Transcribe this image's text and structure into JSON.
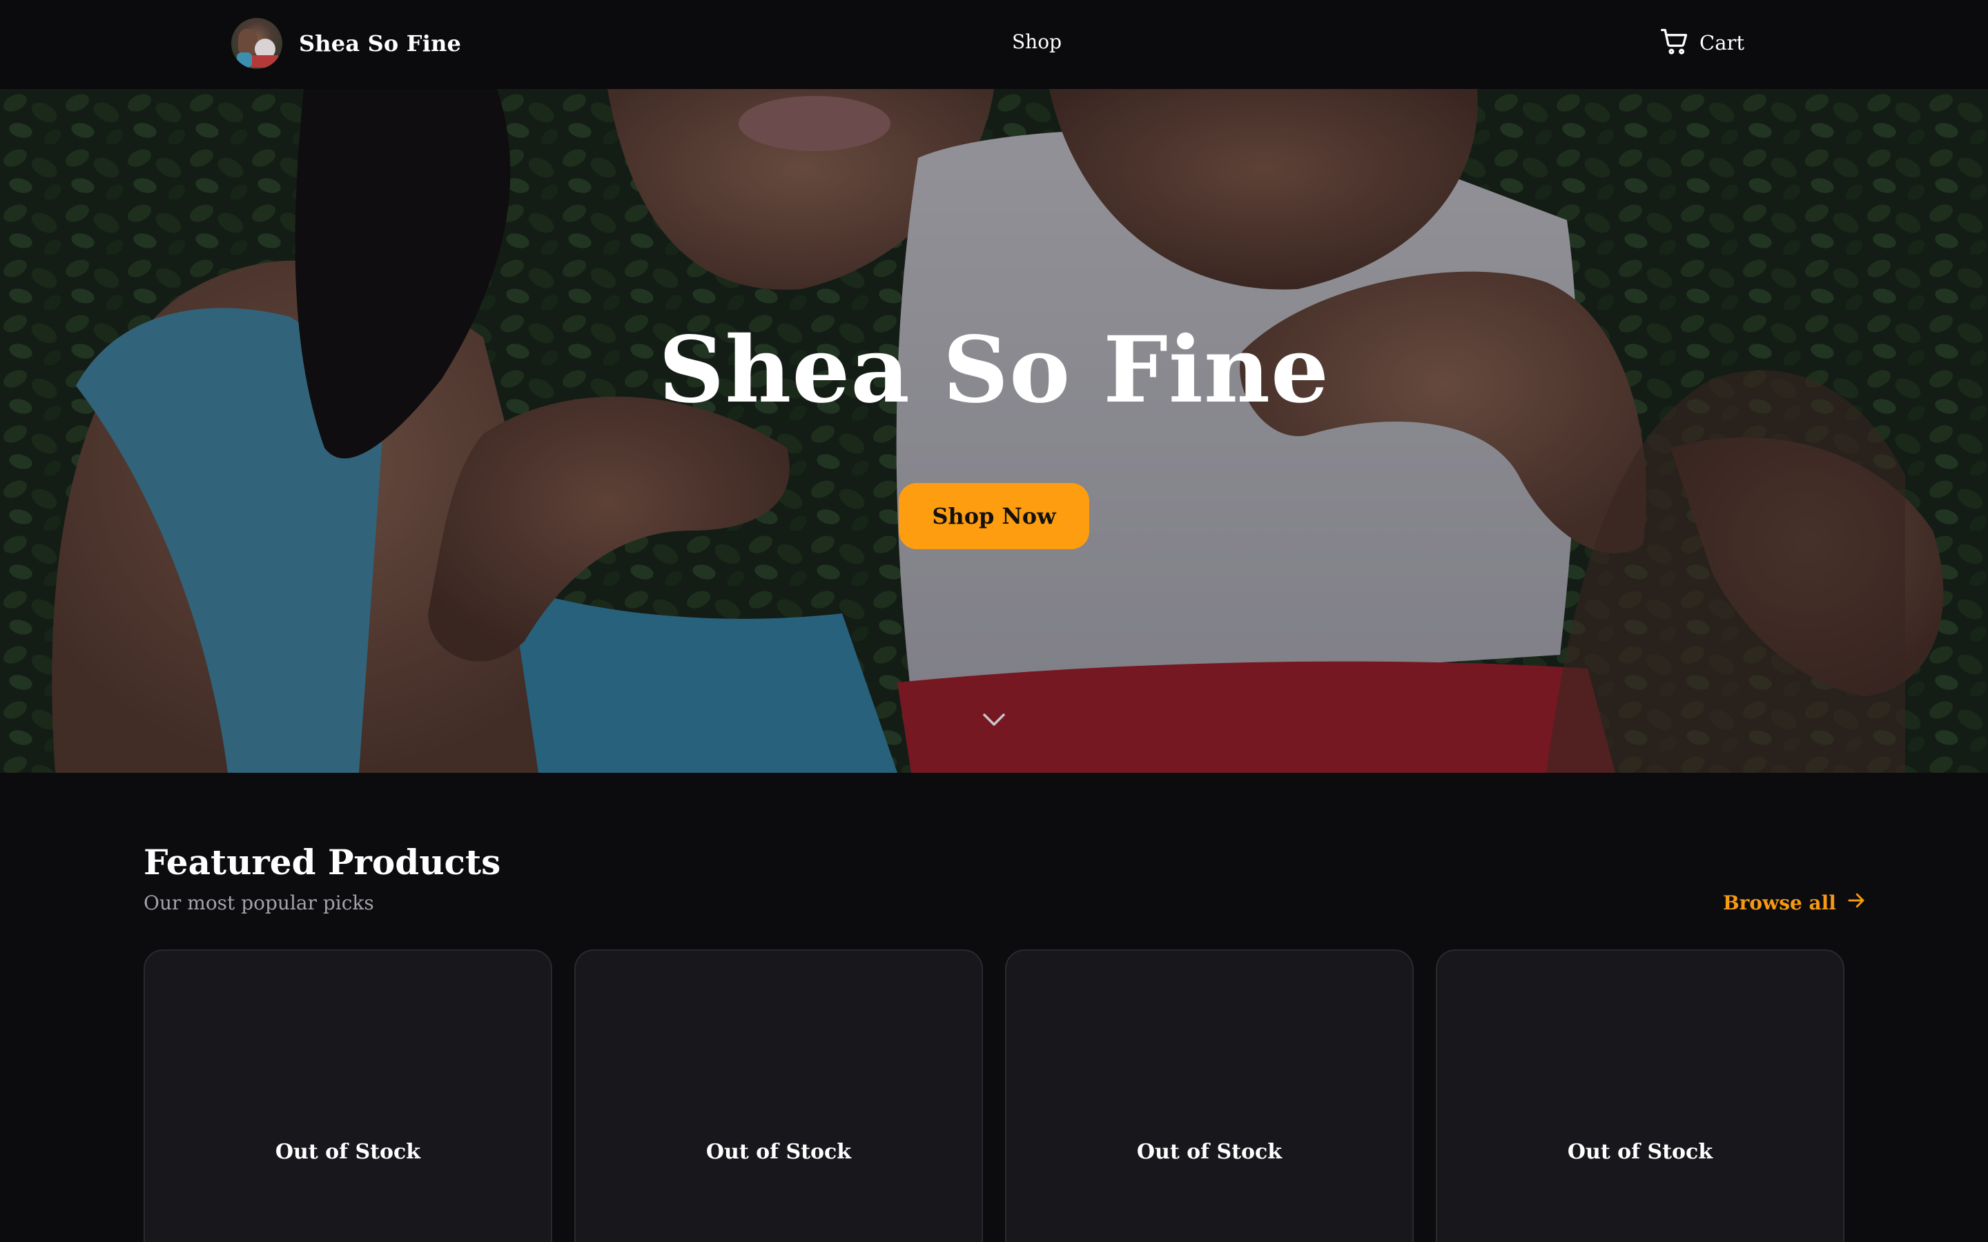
{
  "header": {
    "brand_name": "Shea So Fine",
    "nav": [
      {
        "label": "Shop"
      }
    ],
    "cart_label": "Cart",
    "icons": {
      "cart": "cart-icon",
      "logo": "brand-avatar"
    }
  },
  "hero": {
    "title": "Shea So Fine",
    "cta_label": "Shop Now",
    "scroll_icon": "chevron-down-icon"
  },
  "featured": {
    "title": "Featured Products",
    "subtitle": "Our most popular picks",
    "browse_label": "Browse all",
    "browse_icon": "arrow-right-icon",
    "products": [
      {
        "status": "Out of Stock"
      },
      {
        "status": "Out of Stock"
      },
      {
        "status": "Out of Stock"
      },
      {
        "status": "Out of Stock"
      }
    ]
  },
  "colors": {
    "background": "#0c0b0e",
    "accent": "#fe9d0f",
    "card": "#18171b",
    "muted_text": "#a5a3aa"
  }
}
